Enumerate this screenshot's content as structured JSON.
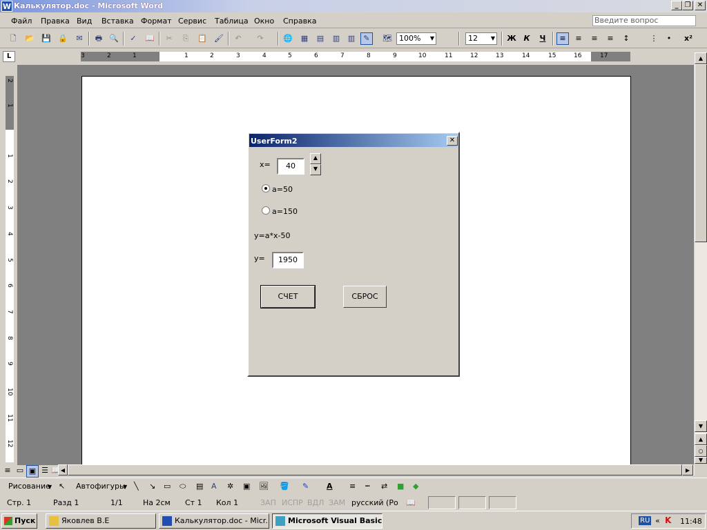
{
  "window": {
    "title": "Калькулятор.doc - Microsoft Word",
    "app_icon": "W"
  },
  "menu": {
    "items": [
      "Файл",
      "Правка",
      "Вид",
      "Вставка",
      "Формат",
      "Сервис",
      "Таблица",
      "Окно",
      "Справка"
    ],
    "question_placeholder": "Введите вопрос"
  },
  "toolbar": {
    "zoom": "100%",
    "font_size": "12",
    "bold": "Ж",
    "italic": "К",
    "underline": "Ч",
    "superscript": "x²"
  },
  "ruler": {
    "h_ticks": [
      "3",
      "2",
      "1",
      "1",
      "2",
      "3",
      "4",
      "5",
      "6",
      "7",
      "8",
      "9",
      "10",
      "11",
      "12",
      "13",
      "14",
      "15",
      "16",
      "17"
    ],
    "v_ticks": [
      "2",
      "1",
      "1",
      "2",
      "3",
      "4",
      "5",
      "6",
      "7",
      "8",
      "9",
      "10",
      "11",
      "12"
    ]
  },
  "userform": {
    "title": "UserForm2",
    "x_label": "x=",
    "x_value": "40",
    "radio_a50": "a=50",
    "radio_a150": "a=150",
    "selected_radio": "a=50",
    "formula": "y=a*x-50",
    "y_label": "y=",
    "y_value": "1950",
    "calc_button": "СЧЕТ",
    "reset_button": "СБРОС"
  },
  "drawbar": {
    "drawing": "Рисование",
    "autoshapes": "Автофигуры"
  },
  "status": {
    "page": "Стр. 1",
    "section": "Разд 1",
    "pages": "1/1",
    "at": "На 2см",
    "line": "Ст 1",
    "col": "Кол 1",
    "rec": "ЗАП",
    "trk": "ИСПР",
    "ext": "ВДЛ",
    "ovr": "ЗАМ",
    "lang": "русский (Ро"
  },
  "taskbar": {
    "start": "Пуск",
    "tasks": [
      "Яковлев В.Е",
      "Калькулятор.doc - Micr...",
      "Microsoft Visual Basic..."
    ],
    "lang": "RU",
    "clock": "11:48"
  },
  "colors": {
    "titlebar_start": "#7a96df",
    "form_title_start": "#0a246a",
    "form_title_end": "#a6caf0",
    "page_bg": "#808080"
  }
}
